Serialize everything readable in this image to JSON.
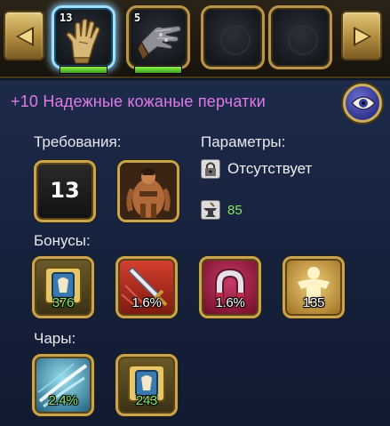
{
  "carousel": {
    "items": [
      {
        "name": "gloves",
        "level": "13",
        "selected": true,
        "bar_fill": 1.0
      },
      {
        "name": "gauntlet",
        "level": "5",
        "selected": false,
        "bar_fill": 1.0
      },
      {
        "name": "empty-slot",
        "level": "",
        "selected": false
      },
      {
        "name": "empty-slot",
        "level": "",
        "selected": false
      }
    ]
  },
  "item": {
    "title": "+10 Надежные кожаные перчатки"
  },
  "requirements": {
    "label": "Требования:",
    "level": "13",
    "class_icon": "warrior-icon"
  },
  "parameters": {
    "label": "Параметры:",
    "lock_text": "Отсутствует",
    "anvil_value": "85"
  },
  "bonuses": {
    "label": "Бонусы:",
    "items": [
      {
        "icon": "shield-armor-icon",
        "value": "376"
      },
      {
        "icon": "sword-crit-icon",
        "value": "1.6%"
      },
      {
        "icon": "magnet-icon",
        "value": "1.6%"
      },
      {
        "icon": "body-stat-icon",
        "value": "135"
      }
    ]
  },
  "enchants": {
    "label": "Чары:",
    "items": [
      {
        "icon": "tornado-icon",
        "value": "2.4%"
      },
      {
        "icon": "shield-armor-icon",
        "value": "243"
      }
    ]
  },
  "colors": {
    "title": "#e07ae6",
    "accent_gold": "#c9a550",
    "positive_green": "#8de060"
  }
}
